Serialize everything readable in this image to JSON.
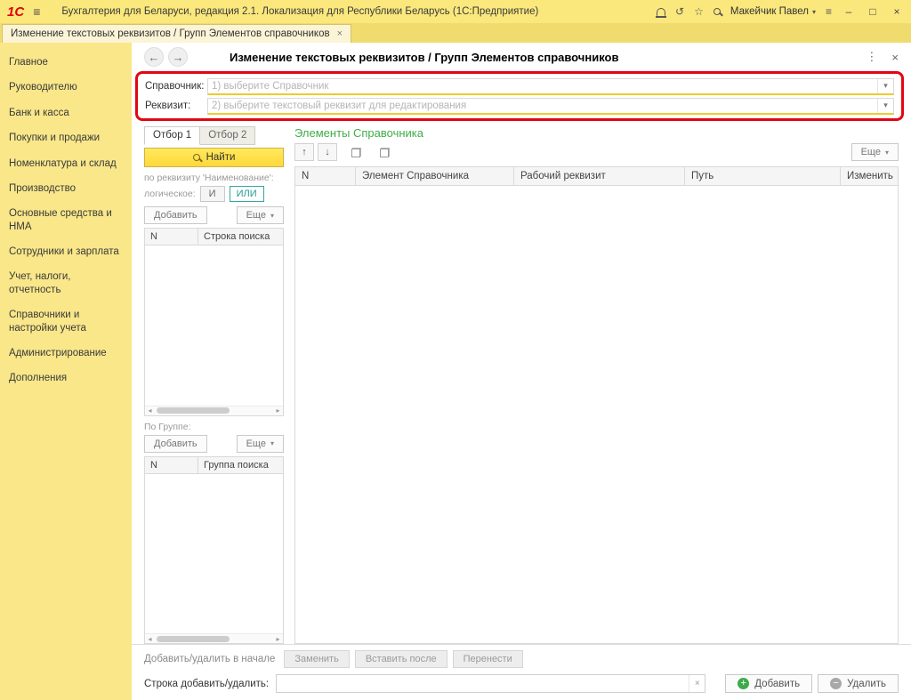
{
  "window": {
    "logo": "1С",
    "title": "Бухгалтерия для Беларуси, редакция 2.1. Локализация для Республики Беларусь  (1С:Предприятие)",
    "user": "Макейчик Павел"
  },
  "icons": {
    "hamburger": "≡",
    "history": "↺",
    "star": "☆",
    "lines": "≡",
    "minimize": "–",
    "maximize": "□",
    "close": "×",
    "back": "←",
    "forward": "→",
    "kebab": "⋮",
    "caret_down": "▾",
    "arrow_up": "↑",
    "arrow_down": "↓",
    "scroll_left": "◂",
    "scroll_right": "▸",
    "clear": "×",
    "plus": "+",
    "minus": "−"
  },
  "tab": {
    "label": "Изменение текстовых реквизитов / Групп Элементов справочников"
  },
  "sidebar": {
    "items": [
      "Главное",
      "Руководителю",
      "Банк и касса",
      "Покупки и продажи",
      "Номенклатура и склад",
      "Производство",
      "Основные средства и НМА",
      "Сотрудники и зарплата",
      "Учет, налоги, отчетность",
      "Справочники и настройки учета",
      "Администрирование",
      "Дополнения"
    ]
  },
  "page": {
    "title": "Изменение текстовых реквизитов / Групп Элементов справочников"
  },
  "form": {
    "catalog_label": "Справочник:",
    "catalog_placeholder": "1) выберите Справочник",
    "attribute_label": "Реквизит:",
    "attribute_placeholder": "2) выберите текстовый реквизит для редактирования"
  },
  "filters": {
    "tab1": "Отбор 1",
    "tab2": "Отбор 2",
    "find": "Найти",
    "by_attribute": "по реквизиту 'Наименование':",
    "logical": "логическое:",
    "and": "И",
    "or": "ИЛИ",
    "add": "Добавить",
    "more": "Еще",
    "search_cols": {
      "n": "N",
      "value": "Строка поиска"
    },
    "by_group": "По Группе:",
    "group_add": "Добавить",
    "group_more": "Еще",
    "group_cols": {
      "n": "N",
      "value": "Группа поиска"
    }
  },
  "elements": {
    "title": "Элементы Справочника",
    "more": "Еще",
    "columns": [
      "N",
      "Элемент Справочника",
      "Рабочий реквизит",
      "Путь",
      "Изменить"
    ]
  },
  "bottom": {
    "mode_label": "Добавить/удалить в начале",
    "replace": "Заменить",
    "insert_after": "Вставить после",
    "move": "Перенести",
    "row_label": "Строка добавить/удалить:",
    "add": "Добавить",
    "delete": "Удалить"
  }
}
